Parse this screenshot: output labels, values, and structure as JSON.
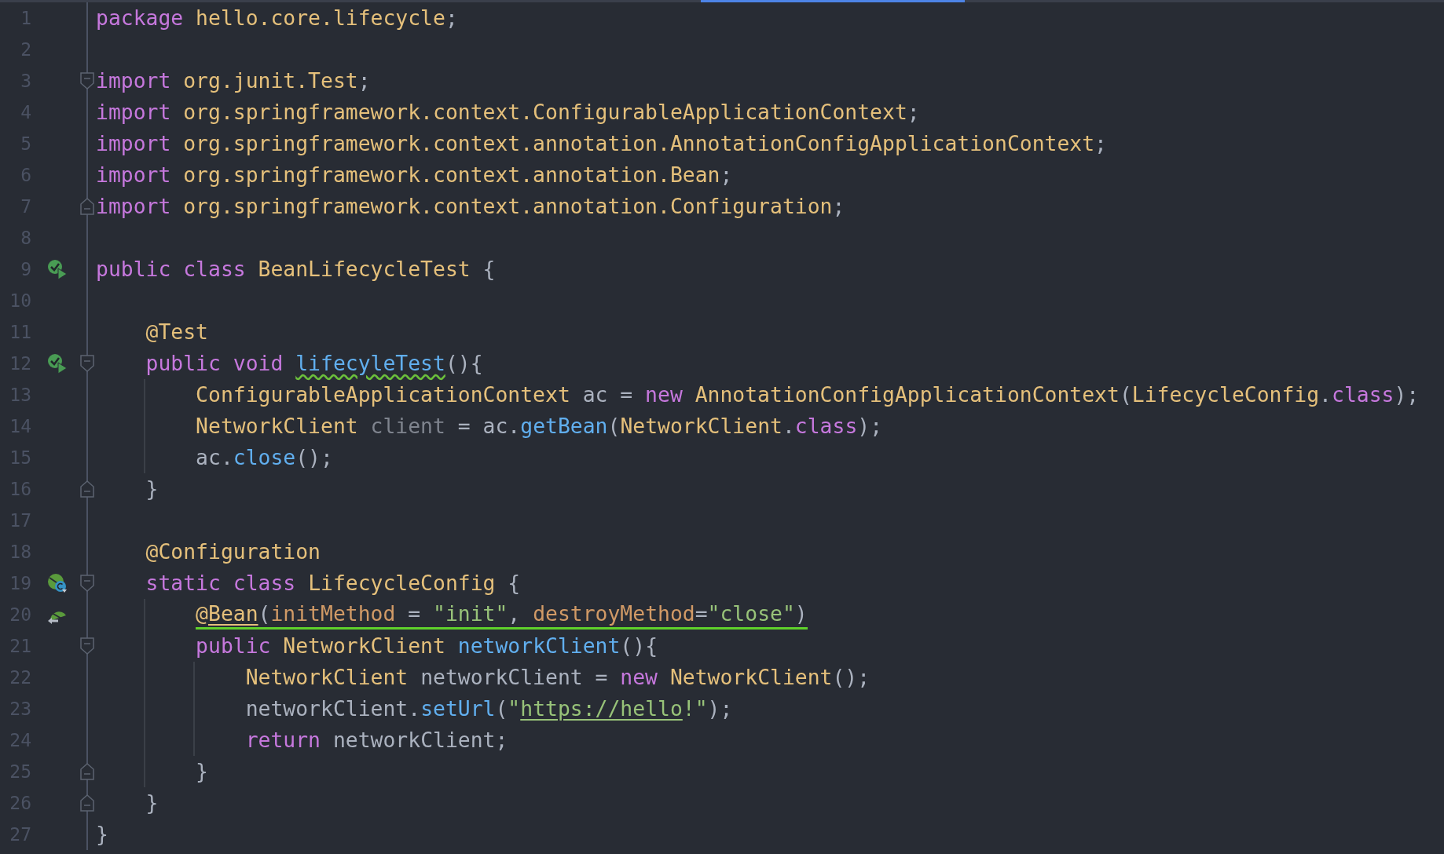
{
  "editor": {
    "lines": [
      {
        "number": "1",
        "tokens": [
          {
            "kind": "keyword",
            "text": "package "
          },
          {
            "kind": "type",
            "text": "hello.core.lifecycle"
          },
          {
            "kind": "plain",
            "text": ";"
          }
        ]
      },
      {
        "number": "2"
      },
      {
        "number": "3",
        "fold_marker": {
          "kind": "start"
        },
        "tokens": [
          {
            "kind": "keyword",
            "text": "import "
          },
          {
            "kind": "type",
            "text": "org.junit.Test"
          },
          {
            "kind": "plain",
            "text": ";"
          }
        ]
      },
      {
        "number": "4",
        "tokens": [
          {
            "kind": "keyword",
            "text": "import "
          },
          {
            "kind": "type",
            "text": "org.springframework.context.ConfigurableApplicationContext"
          },
          {
            "kind": "plain",
            "text": ";"
          }
        ]
      },
      {
        "number": "5",
        "tokens": [
          {
            "kind": "keyword",
            "text": "import "
          },
          {
            "kind": "type",
            "text": "org.springframework.context.annotation.AnnotationConfigApplicationContext"
          },
          {
            "kind": "plain",
            "text": ";"
          }
        ]
      },
      {
        "number": "6",
        "tokens": [
          {
            "kind": "keyword",
            "text": "import "
          },
          {
            "kind": "type",
            "text": "org.springframework.context.annotation.Bean"
          },
          {
            "kind": "plain",
            "text": ";"
          }
        ]
      },
      {
        "number": "7",
        "fold_marker": {
          "kind": "end"
        },
        "tokens": [
          {
            "kind": "keyword",
            "text": "import "
          },
          {
            "kind": "type",
            "text": "org.springframework.context.annotation.Configuration"
          },
          {
            "kind": "plain",
            "text": ";"
          }
        ]
      },
      {
        "number": "8"
      },
      {
        "number": "9",
        "gutter_icon": {
          "kind": "run"
        },
        "tokens": [
          {
            "kind": "keyword",
            "text": "public class "
          },
          {
            "kind": "type",
            "text": "BeanLifecycleTest"
          },
          {
            "kind": "plain",
            "text": " {"
          }
        ]
      },
      {
        "number": "10"
      },
      {
        "number": "11",
        "tokens": [
          {
            "kind": "annotation",
            "text": "    @Test"
          }
        ]
      },
      {
        "number": "12",
        "gutter_icon": {
          "kind": "run"
        },
        "fold_marker": {
          "kind": "start"
        },
        "tokens": [
          {
            "kind": "keyword",
            "text": "    public void "
          },
          {
            "kind": "method",
            "text": "lifecyleTest",
            "decoration": {
              "kind": "wavy"
            }
          },
          {
            "kind": "plain",
            "text": "(){"
          }
        ]
      },
      {
        "number": "13",
        "tokens": [
          {
            "kind": "type",
            "text": "        ConfigurableApplicationContext"
          },
          {
            "kind": "plain",
            "text": " ac = "
          },
          {
            "kind": "keyword",
            "text": "new "
          },
          {
            "kind": "type",
            "text": "AnnotationConfigApplicationContext"
          },
          {
            "kind": "plain",
            "text": "("
          },
          {
            "kind": "type",
            "text": "LifecycleConfig"
          },
          {
            "kind": "plain",
            "text": "."
          },
          {
            "kind": "keyword",
            "text": "class"
          },
          {
            "kind": "plain",
            "text": ");"
          }
        ]
      },
      {
        "number": "14",
        "tokens": [
          {
            "kind": "type",
            "text": "        NetworkClient "
          },
          {
            "kind": "unused",
            "text": "client"
          },
          {
            "kind": "plain",
            "text": " = ac."
          },
          {
            "kind": "method",
            "text": "getBean"
          },
          {
            "kind": "plain",
            "text": "("
          },
          {
            "kind": "type",
            "text": "NetworkClient"
          },
          {
            "kind": "plain",
            "text": "."
          },
          {
            "kind": "keyword",
            "text": "class"
          },
          {
            "kind": "plain",
            "text": ");"
          }
        ]
      },
      {
        "number": "15",
        "tokens": [
          {
            "kind": "plain",
            "text": "        ac."
          },
          {
            "kind": "method",
            "text": "close"
          },
          {
            "kind": "plain",
            "text": "();"
          }
        ]
      },
      {
        "number": "16",
        "fold_marker": {
          "kind": "end"
        },
        "tokens": [
          {
            "kind": "plain",
            "text": "    }"
          }
        ]
      },
      {
        "number": "17"
      },
      {
        "number": "18",
        "tokens": [
          {
            "kind": "annotation",
            "text": "    @Configuration"
          }
        ]
      },
      {
        "number": "19",
        "gutter_icon": {
          "kind": "bean-class"
        },
        "fold_marker": {
          "kind": "start"
        },
        "tokens": [
          {
            "kind": "keyword",
            "text": "    static class "
          },
          {
            "kind": "type",
            "text": "LifecycleConfig"
          },
          {
            "kind": "plain",
            "text": " {"
          }
        ]
      },
      {
        "number": "20",
        "gutter_icon": {
          "kind": "bean-method"
        },
        "highlighted": true,
        "tokens": [
          {
            "kind": "annotation",
            "text": "        @"
          },
          {
            "kind": "annotation",
            "text": "Bean",
            "decoration": {
              "kind": "solid"
            }
          },
          {
            "kind": "plain",
            "text": "("
          },
          {
            "kind": "param",
            "text": "initMethod"
          },
          {
            "kind": "plain",
            "text": " = "
          },
          {
            "kind": "string",
            "text": "\"init\""
          },
          {
            "kind": "plain",
            "text": ", "
          },
          {
            "kind": "param",
            "text": "destroyMethod"
          },
          {
            "kind": "plain",
            "text": "="
          },
          {
            "kind": "string",
            "text": "\"close\""
          },
          {
            "kind": "plain",
            "text": ")"
          }
        ]
      },
      {
        "number": "21",
        "fold_marker": {
          "kind": "start"
        },
        "tokens": [
          {
            "kind": "keyword",
            "text": "        public "
          },
          {
            "kind": "type",
            "text": "NetworkClient "
          },
          {
            "kind": "method",
            "text": "networkClient"
          },
          {
            "kind": "plain",
            "text": "(){"
          }
        ]
      },
      {
        "number": "22",
        "tokens": [
          {
            "kind": "type",
            "text": "            NetworkClient "
          },
          {
            "kind": "plain",
            "text": "networkClient = "
          },
          {
            "kind": "keyword",
            "text": "new "
          },
          {
            "kind": "type",
            "text": "NetworkClient"
          },
          {
            "kind": "plain",
            "text": "();"
          }
        ]
      },
      {
        "number": "23",
        "tokens": [
          {
            "kind": "plain",
            "text": "            networkClient."
          },
          {
            "kind": "method",
            "text": "setUrl"
          },
          {
            "kind": "plain",
            "text": "("
          },
          {
            "kind": "string",
            "text": "\""
          },
          {
            "kind": "string",
            "text": "https://hello",
            "decoration": {
              "kind": "solid"
            }
          },
          {
            "kind": "string",
            "text": "!\""
          },
          {
            "kind": "plain",
            "text": ");"
          }
        ]
      },
      {
        "number": "24",
        "tokens": [
          {
            "kind": "keyword",
            "text": "            return "
          },
          {
            "kind": "plain",
            "text": "networkClient;"
          }
        ]
      },
      {
        "number": "25",
        "fold_marker": {
          "kind": "end"
        },
        "tokens": [
          {
            "kind": "plain",
            "text": "        }"
          }
        ]
      },
      {
        "number": "26",
        "fold_marker": {
          "kind": "end"
        },
        "tokens": [
          {
            "kind": "plain",
            "text": "    }"
          }
        ]
      },
      {
        "number": "27",
        "tokens": [
          {
            "kind": "plain",
            "text": "}"
          }
        ]
      }
    ]
  }
}
